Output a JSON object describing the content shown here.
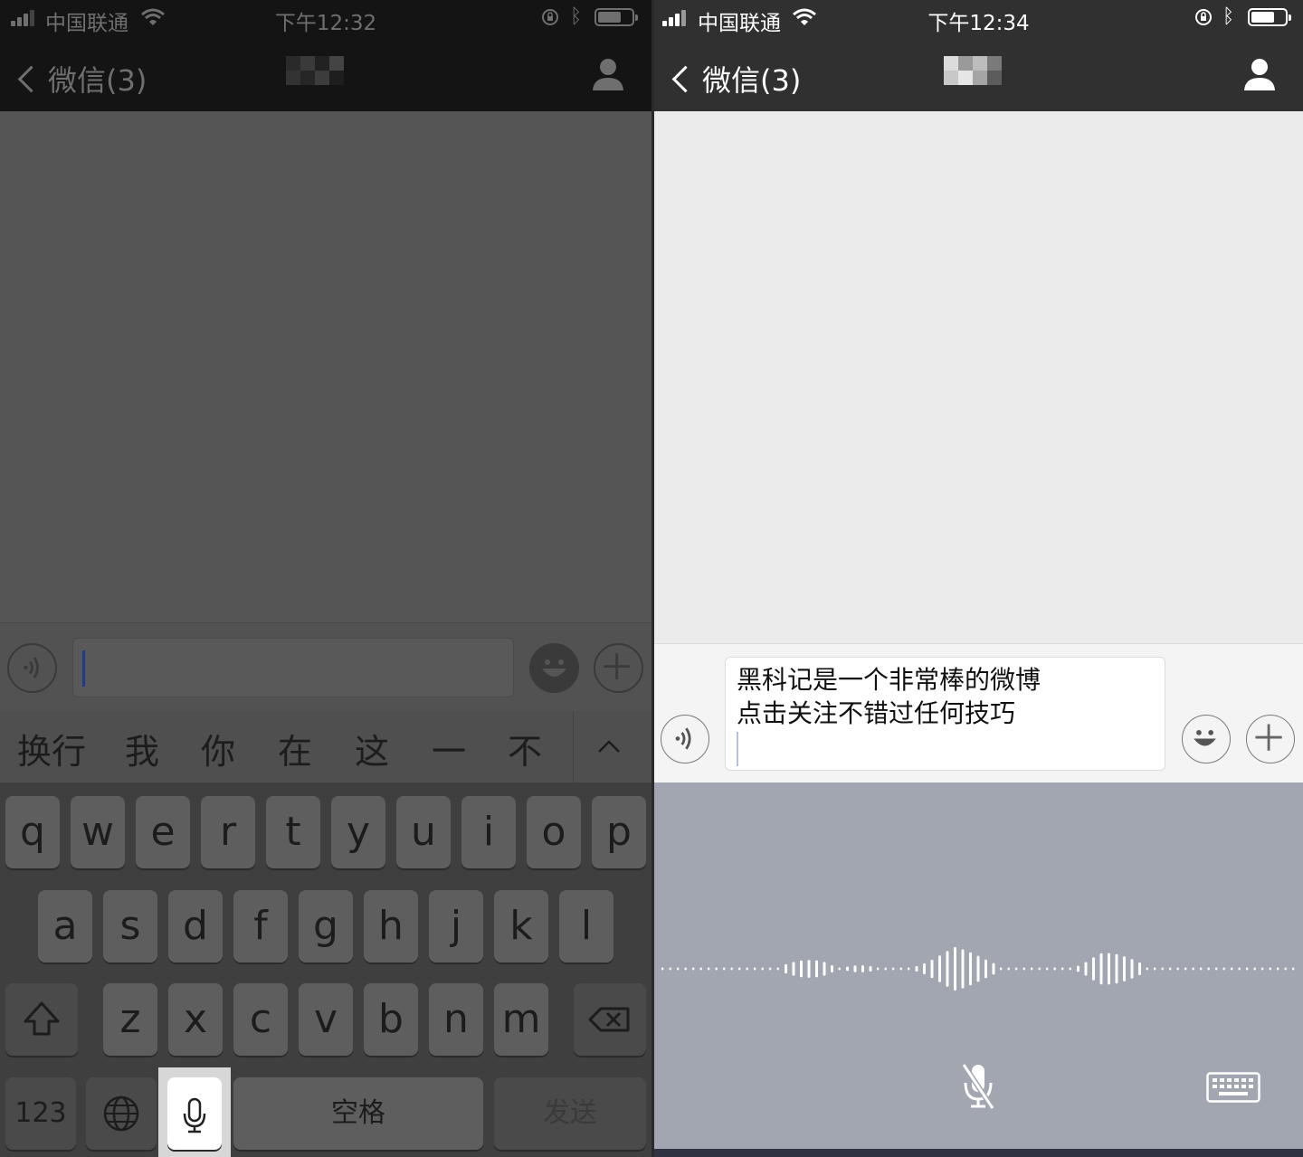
{
  "left": {
    "status": {
      "carrier": "中国联通",
      "time": "下午12:32"
    },
    "nav": {
      "back_label": "微信(3)"
    },
    "candidates": [
      "换行",
      "我",
      "你",
      "在",
      "这",
      "一",
      "不"
    ],
    "keys": {
      "row1": [
        "q",
        "w",
        "e",
        "r",
        "t",
        "y",
        "u",
        "i",
        "o",
        "p"
      ],
      "row2": [
        "a",
        "s",
        "d",
        "f",
        "g",
        "h",
        "j",
        "k",
        "l"
      ],
      "row3": [
        "z",
        "x",
        "c",
        "v",
        "b",
        "n",
        "m"
      ],
      "numbers_label": "123",
      "space_label": "空格",
      "send_label": "发送"
    }
  },
  "right": {
    "status": {
      "carrier": "中国联通",
      "time": "下午12:34"
    },
    "nav": {
      "back_label": "微信(3)"
    },
    "input": {
      "line1": "黑科记是一个非常棒的微博",
      "line2": "点击关注不错过任何技巧"
    }
  },
  "colors": {
    "left_bar": "#141414",
    "right_bar": "#303030",
    "voice_panel": "#a2a6b1",
    "chat_bg_right": "#ebebeb"
  }
}
